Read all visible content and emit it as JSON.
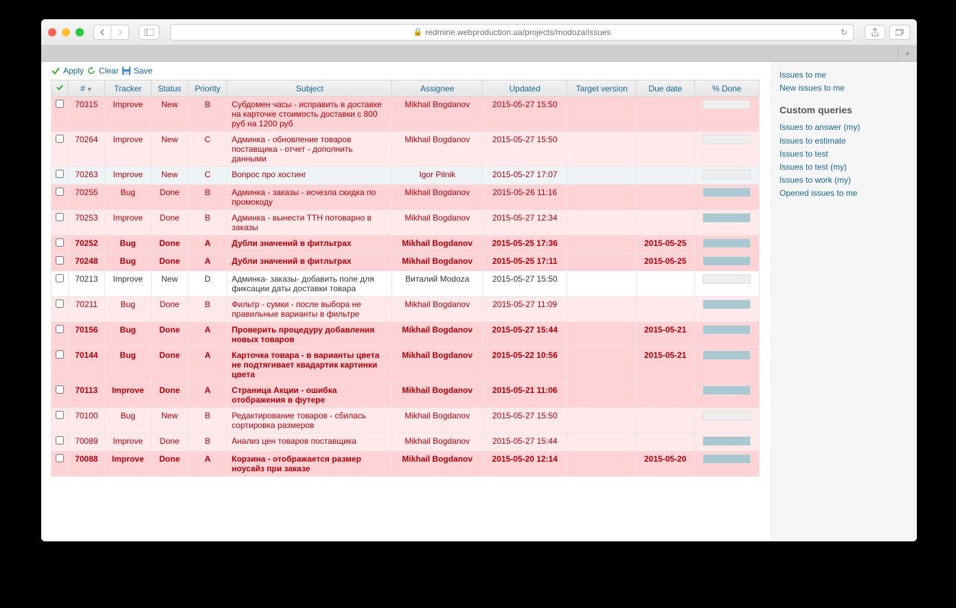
{
  "browser": {
    "url": "redmine.webproduction.ua/projects/modoza/issues"
  },
  "actions": {
    "apply": "Apply",
    "clear": "Clear",
    "save": "Save"
  },
  "columns": {
    "num": "#",
    "tracker": "Tracker",
    "status": "Status",
    "priority": "Priority",
    "subject": "Subject",
    "assignee": "Assignee",
    "updated": "Updated",
    "target_version": "Target version",
    "due_date": "Due date",
    "done": "% Done"
  },
  "issues": [
    {
      "id": "70315",
      "tracker": "Improve",
      "status": "New",
      "priority": "B",
      "subject": "Субдомен часы - исправить в доставке на карточке стоимость доставки с 800 руб на 1200 руб",
      "assignee": "Mikhail Bogdanov",
      "updated": "2015-05-27 15:50",
      "target": "",
      "due": "",
      "done": false,
      "rowclass": "row-odd",
      "bold": false,
      "red": true
    },
    {
      "id": "70264",
      "tracker": "Improve",
      "status": "New",
      "priority": "C",
      "subject": "Админка - обновление товаров поставщика - отчет - дополнить данными",
      "assignee": "Mikhail Bogdanov",
      "updated": "2015-05-27 15:50",
      "target": "",
      "due": "",
      "done": false,
      "rowclass": "row-even",
      "bold": false,
      "red": true
    },
    {
      "id": "70263",
      "tracker": "Improve",
      "status": "New",
      "priority": "C",
      "subject": "Вопрос про хостинг",
      "assignee": "Igor Pilnik",
      "updated": "2015-05-27 17:07",
      "target": "",
      "due": "",
      "done": false,
      "rowclass": "row-blue",
      "bold": false,
      "red": true
    },
    {
      "id": "70255",
      "tracker": "Bug",
      "status": "Done",
      "priority": "B",
      "subject": "Админка - заказы - исчезла скидка по промокоду",
      "assignee": "Mikhail Bogdanov",
      "updated": "2015-05-26 11:16",
      "target": "",
      "due": "",
      "done": true,
      "rowclass": "row-odd",
      "bold": false,
      "red": true
    },
    {
      "id": "70253",
      "tracker": "Improve",
      "status": "Done",
      "priority": "B",
      "subject": "Админка - вынести ТТН потоварно в заказы",
      "assignee": "Mikhail Bogdanov",
      "updated": "2015-05-27 12:34",
      "target": "",
      "due": "",
      "done": true,
      "rowclass": "row-even",
      "bold": false,
      "red": true
    },
    {
      "id": "70252",
      "tracker": "Bug",
      "status": "Done",
      "priority": "A",
      "subject": "Дубли значений в фитльтрах",
      "assignee": "Mikhail Bogdanov",
      "updated": "2015-05-25 17:36",
      "target": "",
      "due": "2015-05-25",
      "done": true,
      "rowclass": "row-odd",
      "bold": true,
      "red": true
    },
    {
      "id": "70248",
      "tracker": "Bug",
      "status": "Done",
      "priority": "A",
      "subject": "Дубли значений в фитльтрах",
      "assignee": "Mikhail Bogdanov",
      "updated": "2015-05-25 17:11",
      "target": "",
      "due": "2015-05-25",
      "done": true,
      "rowclass": "row-odd",
      "bold": true,
      "red": true
    },
    {
      "id": "70213",
      "tracker": "Improve",
      "status": "New",
      "priority": "D",
      "subject": "Админка- заказы- добавить поле для фиксации даты доставки товара",
      "assignee": "Виталий Modoza",
      "updated": "2015-05-27 15:50",
      "target": "",
      "due": "",
      "done": false,
      "rowclass": "row-white",
      "bold": false,
      "red": false
    },
    {
      "id": "70211",
      "tracker": "Bug",
      "status": "Done",
      "priority": "B",
      "subject": "Фильтр - сумки - после выбора не правильные варианты в фильтре",
      "assignee": "Mikhail Bogdanov",
      "updated": "2015-05-27 11:09",
      "target": "",
      "due": "",
      "done": true,
      "rowclass": "row-even",
      "bold": false,
      "red": true
    },
    {
      "id": "70156",
      "tracker": "Bug",
      "status": "Done",
      "priority": "A",
      "subject": "Проверить процедуру добавления новых товаров",
      "assignee": "Mikhail Bogdanov",
      "updated": "2015-05-27 15:44",
      "target": "",
      "due": "2015-05-21",
      "done": true,
      "rowclass": "row-odd",
      "bold": true,
      "red": true
    },
    {
      "id": "70144",
      "tracker": "Bug",
      "status": "Done",
      "priority": "A",
      "subject": "Карточка товара - в варианты цвета не подтягивает квадартик картинки цвета",
      "assignee": "Mikhail Bogdanov",
      "updated": "2015-05-22 10:56",
      "target": "",
      "due": "2015-05-21",
      "done": true,
      "rowclass": "row-odd",
      "bold": true,
      "red": true
    },
    {
      "id": "70113",
      "tracker": "Improve",
      "status": "Done",
      "priority": "A",
      "subject": "Страница Акции - ошибка отображения в футере",
      "assignee": "Mikhail Bogdanov",
      "updated": "2015-05-21 11:06",
      "target": "",
      "due": "",
      "done": true,
      "rowclass": "row-odd",
      "bold": true,
      "red": true
    },
    {
      "id": "70100",
      "tracker": "Bug",
      "status": "New",
      "priority": "B",
      "subject": "Редактирование товаров - сбилась сортировка размеров",
      "assignee": "Mikhail Bogdanov",
      "updated": "2015-05-27 15:50",
      "target": "",
      "due": "",
      "done": false,
      "rowclass": "row-even",
      "bold": false,
      "red": true
    },
    {
      "id": "70089",
      "tracker": "Improve",
      "status": "Done",
      "priority": "B",
      "subject": "Анализ цен товаров поставщика",
      "assignee": "Mikhail Bogdanov",
      "updated": "2015-05-27 15:44",
      "target": "",
      "due": "",
      "done": true,
      "rowclass": "row-even",
      "bold": false,
      "red": true
    },
    {
      "id": "70088",
      "tracker": "Improve",
      "status": "Done",
      "priority": "A",
      "subject": "Корзина - отображается размер ноусайз при заказе",
      "assignee": "Mikhail Bogdanov",
      "updated": "2015-05-20 12:14",
      "target": "",
      "due": "2015-05-20",
      "done": true,
      "rowclass": "row-odd",
      "bold": true,
      "red": true
    }
  ],
  "sidebar": {
    "top_links": [
      "Issues to me",
      "New issues to me"
    ],
    "heading": "Custom queries",
    "queries": [
      "Issues to answer (my)",
      "Issues to estimate",
      "Issues to test",
      "Issues to test (my)",
      "Issues to work (my)",
      "Opened issues to me"
    ]
  }
}
